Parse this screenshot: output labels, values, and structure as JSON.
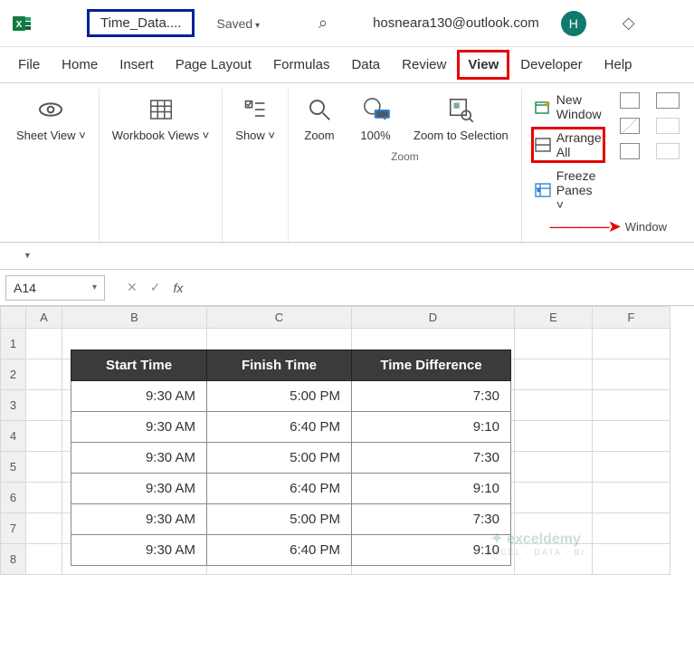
{
  "title": {
    "doc_name": "Time_Data....",
    "saved": "Saved",
    "email": "hosneara130@outlook.com",
    "avatar_initial": "H"
  },
  "tabs": [
    "File",
    "Home",
    "Insert",
    "Page Layout",
    "Formulas",
    "Data",
    "Review",
    "View",
    "Developer",
    "Help"
  ],
  "active_tab_index": 7,
  "ribbon": {
    "sheet_view": "Sheet View ˅",
    "workbook_views": "Workbook Views ˅",
    "show": "Show ˅",
    "zoom": "Zoom",
    "zoom100": "100%",
    "zoom_sel": "Zoom to Selection",
    "zoom_group": "Zoom",
    "win_new": "New Window",
    "win_arrange": "Arrange All",
    "win_freeze": "Freeze Panes ˅",
    "window_group": "Window"
  },
  "namebox": "A14",
  "fx": {
    "cancel": "✕",
    "confirm": "✓",
    "fx": "fx"
  },
  "columns": [
    "A",
    "B",
    "C",
    "D",
    "E",
    "F"
  ],
  "rows": [
    "1",
    "2",
    "3",
    "4",
    "5",
    "6",
    "7",
    "8"
  ],
  "chart_data": {
    "type": "table",
    "headers": [
      "Start Time",
      "Finish Time",
      "Time Difference"
    ],
    "rows": [
      [
        "9:30 AM",
        "5:00 PM",
        "7:30"
      ],
      [
        "9:30 AM",
        "6:40 PM",
        "9:10"
      ],
      [
        "9:30 AM",
        "5:00 PM",
        "7:30"
      ],
      [
        "9:30 AM",
        "6:40 PM",
        "9:10"
      ],
      [
        "9:30 AM",
        "5:00 PM",
        "7:30"
      ],
      [
        "9:30 AM",
        "6:40 PM",
        "9:10"
      ]
    ]
  },
  "watermark": {
    "brand": "exceldemy",
    "tagline": "EXCEL · DATA · BI"
  }
}
